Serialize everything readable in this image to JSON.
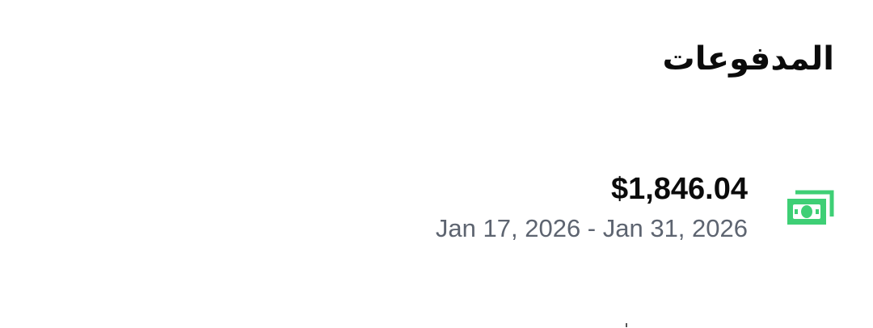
{
  "header": {
    "title": "المدفوعات"
  },
  "payment": {
    "icon": "money-bill-icon",
    "icon_color": "#3ecf75",
    "amount": "$1,846.04",
    "date_range": "Jan 17, 2026 - Jan 31, 2026"
  }
}
